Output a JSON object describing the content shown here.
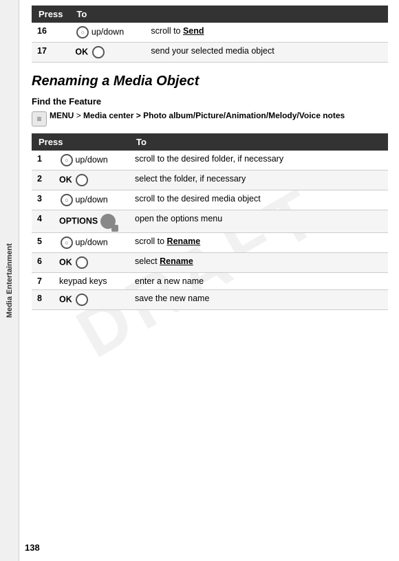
{
  "page": {
    "number": "138",
    "watermark": "DRAFT",
    "sidebar_label": "Media Entertainment"
  },
  "top_table": {
    "headers": [
      "Press",
      "To"
    ],
    "rows": [
      {
        "num": "16",
        "press": "up/down",
        "press_type": "nav",
        "to": "scroll to Send",
        "to_bold": "Send"
      },
      {
        "num": "17",
        "press": "OK",
        "press_type": "ok",
        "to": "send your selected media object",
        "to_bold": ""
      }
    ]
  },
  "section": {
    "title": "Renaming a Media Object",
    "subsection": "Find the Feature",
    "menu_label": "MENU",
    "menu_arrow": ">",
    "menu_path": "Media center > Photo album/Picture/Animation/Melody/Voice notes"
  },
  "main_table": {
    "headers": [
      "Press",
      "To"
    ],
    "rows": [
      {
        "num": "1",
        "press": "up/down",
        "press_type": "nav",
        "to": "scroll to the desired folder, if necessary"
      },
      {
        "num": "2",
        "press": "OK",
        "press_type": "ok",
        "to": "select the folder, if necessary"
      },
      {
        "num": "3",
        "press": "up/down",
        "press_type": "nav",
        "to": "scroll to the desired media object"
      },
      {
        "num": "4",
        "press": "OPTIONS",
        "press_type": "options",
        "to": "open the options menu"
      },
      {
        "num": "5",
        "press": "up/down",
        "press_type": "nav",
        "to": "scroll to Rename",
        "to_bold": "Rename"
      },
      {
        "num": "6",
        "press": "OK",
        "press_type": "ok",
        "to": "select Rename",
        "to_bold": "Rename"
      },
      {
        "num": "7",
        "press": "keypad keys",
        "press_type": "text",
        "to": "enter a new name"
      },
      {
        "num": "8",
        "press": "OK",
        "press_type": "ok",
        "to": "save the new name"
      }
    ]
  }
}
